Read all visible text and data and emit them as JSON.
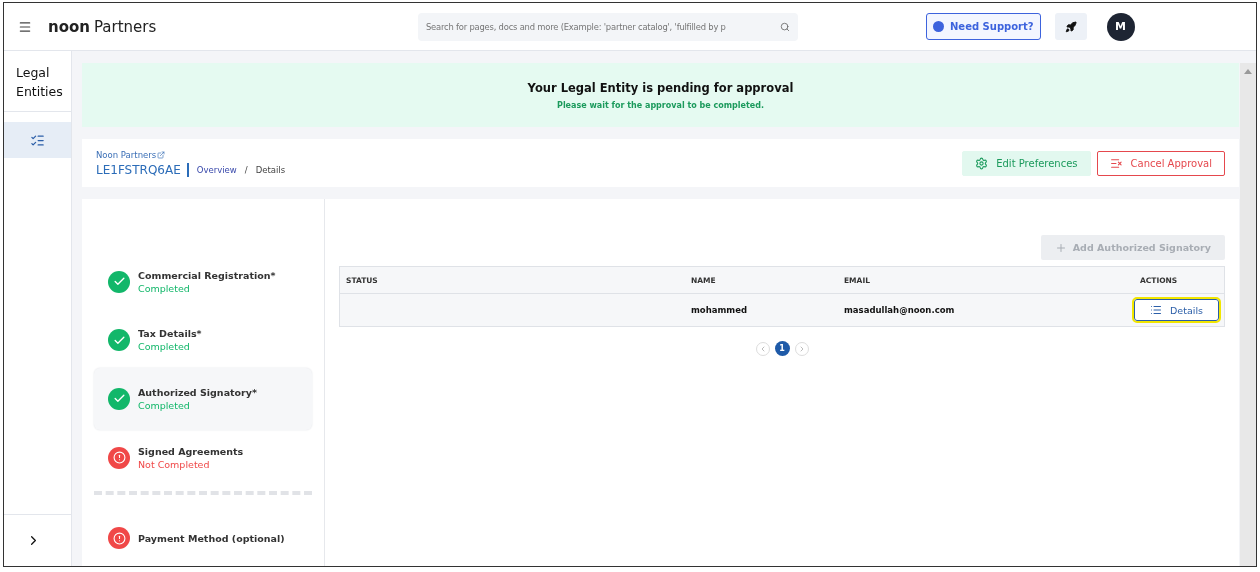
{
  "header": {
    "brand_bold": "noon",
    "brand_light": "Partners",
    "search": {
      "placeholder": "Search for pages, docs and more (Example: 'partner catalog', 'fulfilled by p"
    },
    "support_button": "Need Support?",
    "avatar": "M"
  },
  "sidebar": {
    "title": "Legal Entities",
    "items": [
      {
        "selected": true
      }
    ]
  },
  "banner": {
    "title": "Your Legal Entity is pending for approval",
    "subtitle": "Please wait for the approval to be completed."
  },
  "page_header": {
    "parent_link": "Noon Partners",
    "entity_id": "LE1FSTRQ6AE",
    "breadcrumb_separator": "/",
    "breadcrumb": [
      {
        "label": "Overview",
        "selected": false
      },
      {
        "label": "Details",
        "selected": true
      }
    ],
    "buttons": [
      {
        "kind": "edit",
        "label": "Edit Preferences"
      },
      {
        "kind": "cancel",
        "label": "Cancel Approval"
      }
    ]
  },
  "steps": [
    {
      "title": "Commercial Registration*",
      "completed": true,
      "status_text": "Completed",
      "selected": false
    },
    {
      "title": "Tax Details*",
      "completed": true,
      "status_text": "Completed",
      "selected": false
    },
    {
      "title": "Authorized Signatory*",
      "completed": true,
      "status_text": "Completed",
      "selected": true
    },
    {
      "title": "Signed Agreements",
      "completed": false,
      "status_text": "Not Completed",
      "selected": false
    },
    {
      "title": "Payment Method (optional)",
      "completed": false,
      "selected": false
    }
  ],
  "add_button": {
    "label": "Add Authorized Signatory",
    "disabled": true
  },
  "table": {
    "columns": [
      "STATUS",
      "NAME",
      "EMAIL",
      "ACTIONS"
    ],
    "rows": [
      {
        "name": "mohammed",
        "email": "masadullah@noon.com",
        "action": "Details"
      }
    ]
  },
  "pagination": {
    "pages": [
      {
        "label": "1",
        "selected": true
      }
    ]
  }
}
